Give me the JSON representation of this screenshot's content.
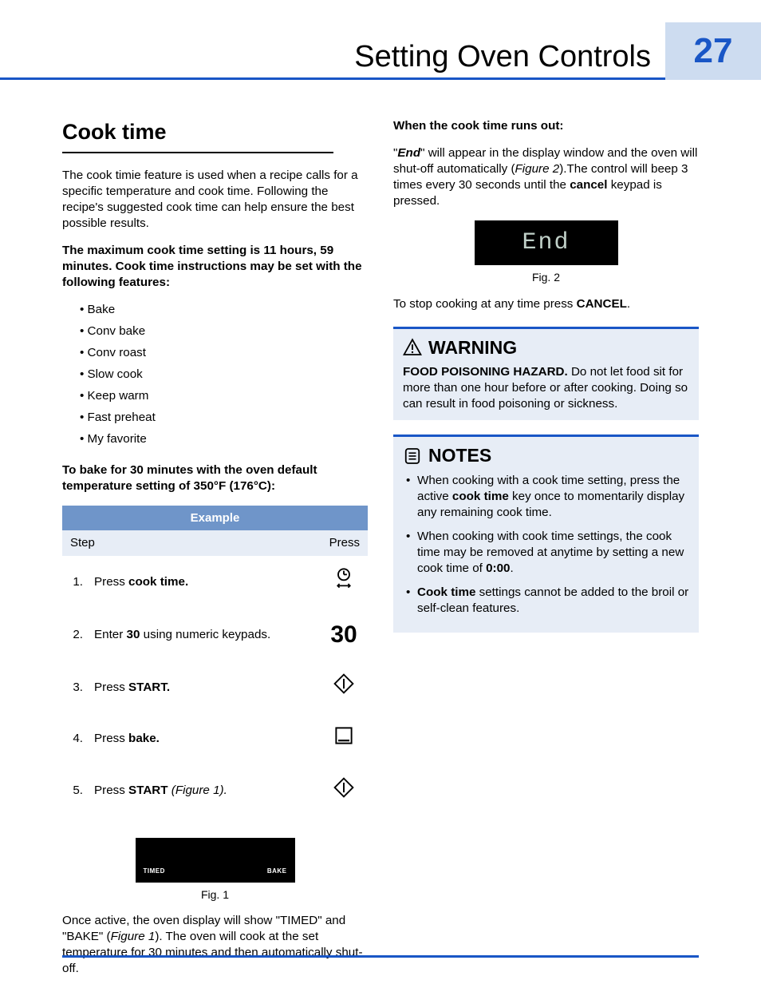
{
  "header": {
    "title": "Setting Oven Controls",
    "page_number": "27"
  },
  "left": {
    "h2": "Cook time",
    "intro": "The cook timie feature is used when a recipe calls for a specific temperature and cook time. Following the recipe's suggested cook time can help ensure the best possible results.",
    "max_prefix": "The maximum cook time setting is 11 hours, 59 minutes. Cook time instructions may be set with the following features:",
    "features": [
      "Bake",
      "Conv bake",
      "Conv roast",
      "Slow cook",
      "Keep warm",
      "Fast preheat",
      "My favorite"
    ],
    "bake_instr": "To bake for 30 minutes with the oven default temperature setting of 350°F (176°C):",
    "table": {
      "header": "Example",
      "sub_step": "Step",
      "sub_press": "Press",
      "rows": [
        {
          "n": "1.",
          "text_pre": "Press ",
          "bold": "cook time.",
          "icon": "clock"
        },
        {
          "n": "2.",
          "text_pre": "Enter ",
          "bold": "30",
          "text_post": " using numeric keypads.",
          "icon": "30"
        },
        {
          "n": "3.",
          "text_pre": "Press ",
          "bold": "START.",
          "icon": "start"
        },
        {
          "n": "4.",
          "text_pre": "Press ",
          "bold": "bake.",
          "icon": "bake"
        },
        {
          "n": "5.",
          "text_pre": "Press ",
          "bold": "START",
          "ital": " (Figure 1).",
          "icon": "start"
        }
      ]
    },
    "fig1": {
      "timed": "TIMED",
      "bake": "BAKE",
      "caption": "Fig. 1"
    },
    "after_fig1_a": "Once active, the oven display will show \"TIMED\" and  \"BAKE\" (",
    "after_fig1_ital": "Figure 1",
    "after_fig1_b": "). The oven will cook at the set temperature for 30 minutes and then automatically shut-off."
  },
  "right": {
    "runs_out_hdr": "When the cook time runs out:",
    "runs_out_a": "\"",
    "runs_out_end": "End",
    "runs_out_b": "\" will appear in the display window and the oven will shut-off automatically (",
    "runs_out_fig": "Figure 2",
    "runs_out_c": ").The control will beep 3 times every 30 seconds until the ",
    "runs_out_cancel": "cancel",
    "runs_out_d": " keypad is pressed.",
    "fig2_text": "End",
    "fig2_caption": "Fig. 2",
    "stop_a": "To stop cooking at any time press ",
    "stop_b": "CANCEL",
    "stop_c": ".",
    "warning": {
      "title": "WARNING",
      "bold": "FOOD POISONING HAZARD.",
      "rest": " Do not let food sit for more than one hour before or after cooking. Doing so can result in food poisoning or sickness."
    },
    "notes": {
      "title": "NOTES",
      "items": [
        {
          "pre": "When cooking with a cook time setting, press the active ",
          "bold": "cook time",
          "post": " key once to momentarily display any remaining cook time."
        },
        {
          "pre": "When cooking with cook time settings, the cook time may be removed at anytime by setting a new cook time of ",
          "bold": "0:00",
          "post": "."
        },
        {
          "boldlead": "Cook time",
          "post": " settings cannot be added to the broil or self-clean features."
        }
      ]
    }
  }
}
